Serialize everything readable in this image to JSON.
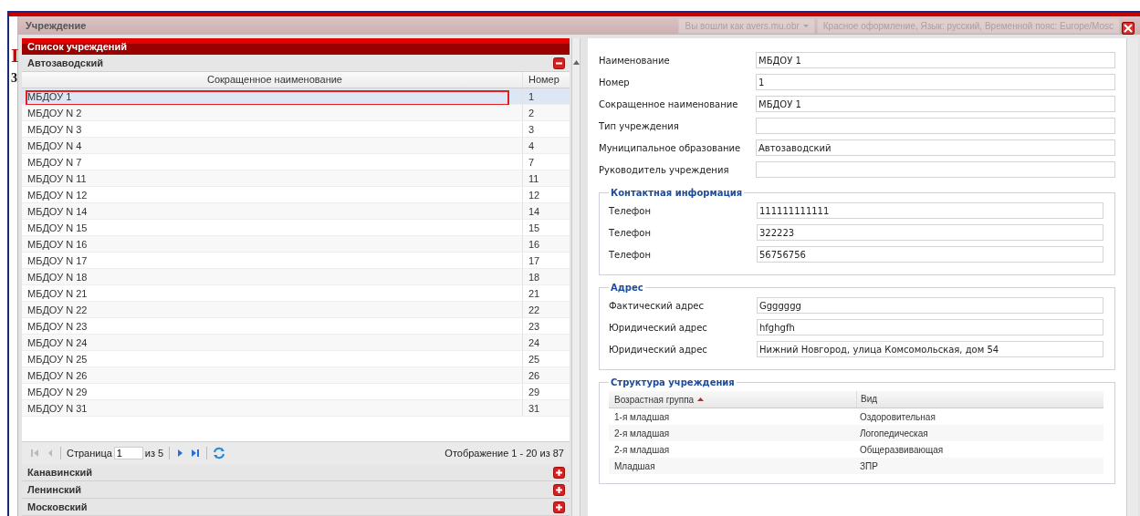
{
  "background_marks": [
    "I",
    "3"
  ],
  "window": {
    "title": "Учреждение",
    "user_menu": "Вы вошли как avers.mu.obr",
    "settings_info": "Красное оформление, Язык: русский, Временной пояс: Europe/Mosc"
  },
  "list_panel": {
    "title": "Список учреждений",
    "groups": [
      {
        "name": "Автозаводский",
        "expanded": true,
        "columns": [
          "Сокращенное наименование",
          "Номер"
        ],
        "rows": [
          {
            "name": "МБДОУ 1",
            "number": "1",
            "selected": true
          },
          {
            "name": "МБДОУ N 2",
            "number": "2",
            "selected": false
          },
          {
            "name": "МБДОУ N 3",
            "number": "3",
            "selected": false
          },
          {
            "name": "МБДОУ N 4",
            "number": "4",
            "selected": false
          },
          {
            "name": "МБДОУ N 7",
            "number": "7",
            "selected": false
          },
          {
            "name": "МБДОУ N 11",
            "number": "11",
            "selected": false
          },
          {
            "name": "МБДОУ N 12",
            "number": "12",
            "selected": false
          },
          {
            "name": "МБДОУ N 14",
            "number": "14",
            "selected": false
          },
          {
            "name": "МБДОУ N 15",
            "number": "15",
            "selected": false
          },
          {
            "name": "МБДОУ N 16",
            "number": "16",
            "selected": false
          },
          {
            "name": "МБДОУ N 17",
            "number": "17",
            "selected": false
          },
          {
            "name": "МБДОУ N 18",
            "number": "18",
            "selected": false
          },
          {
            "name": "МБДОУ N 21",
            "number": "21",
            "selected": false
          },
          {
            "name": "МБДОУ N 22",
            "number": "22",
            "selected": false
          },
          {
            "name": "МБДОУ N 23",
            "number": "23",
            "selected": false
          },
          {
            "name": "МБДОУ N 24",
            "number": "24",
            "selected": false
          },
          {
            "name": "МБДОУ N 25",
            "number": "25",
            "selected": false
          },
          {
            "name": "МБДОУ N 26",
            "number": "26",
            "selected": false
          },
          {
            "name": "МБДОУ N 29",
            "number": "29",
            "selected": false
          },
          {
            "name": "МБДОУ N 31",
            "number": "31",
            "selected": false
          }
        ],
        "paging": {
          "page_label": "Страница",
          "page_value": "1",
          "of_label": "из 5",
          "display": "Отображение 1 - 20 из 87"
        }
      },
      {
        "name": "Канавинский",
        "expanded": false
      },
      {
        "name": "Ленинский",
        "expanded": false
      },
      {
        "name": "Московский",
        "expanded": false
      }
    ]
  },
  "form": {
    "fields": [
      {
        "label": "Наименование",
        "value": "МБДОУ 1"
      },
      {
        "label": "Номер",
        "value": "1"
      },
      {
        "label": "Сокращенное наименование",
        "value": "МБДОУ 1"
      },
      {
        "label": "Тип учреждения"
      },
      {
        "label": "Муниципальное образование",
        "value": "Автозаводский"
      },
      {
        "label": "Руководитель учреждения"
      }
    ],
    "fieldsets": [
      {
        "title": "Контактная информация",
        "fields": [
          {
            "label": "Телефон",
            "value": "111111111111"
          },
          {
            "label": "Телефон",
            "value": "322223"
          },
          {
            "label": "Телефон",
            "value": "56756756"
          }
        ]
      },
      {
        "title": "Адрес",
        "fields": [
          {
            "label": "Фактический адрес",
            "value": "Ggggggg"
          },
          {
            "label": "Юридический адрес",
            "value": "hfghgfh"
          },
          {
            "label": "Юридический адрес",
            "value": "Нижний Новгород, улица Комсомольская, дом 54"
          }
        ]
      }
    ],
    "structure": {
      "title": "Структура учреждения",
      "columns": [
        "Возрастная группа",
        "Вид"
      ],
      "sort_ascending": true,
      "rows": [
        [
          "1-я младшая",
          "Оздоровительная"
        ],
        [
          "2-я младшая",
          "Логопедическая"
        ],
        [
          "2-я младшая",
          "Общеразвивающая"
        ],
        [
          "Младшая",
          "ЗПР"
        ]
      ]
    }
  }
}
